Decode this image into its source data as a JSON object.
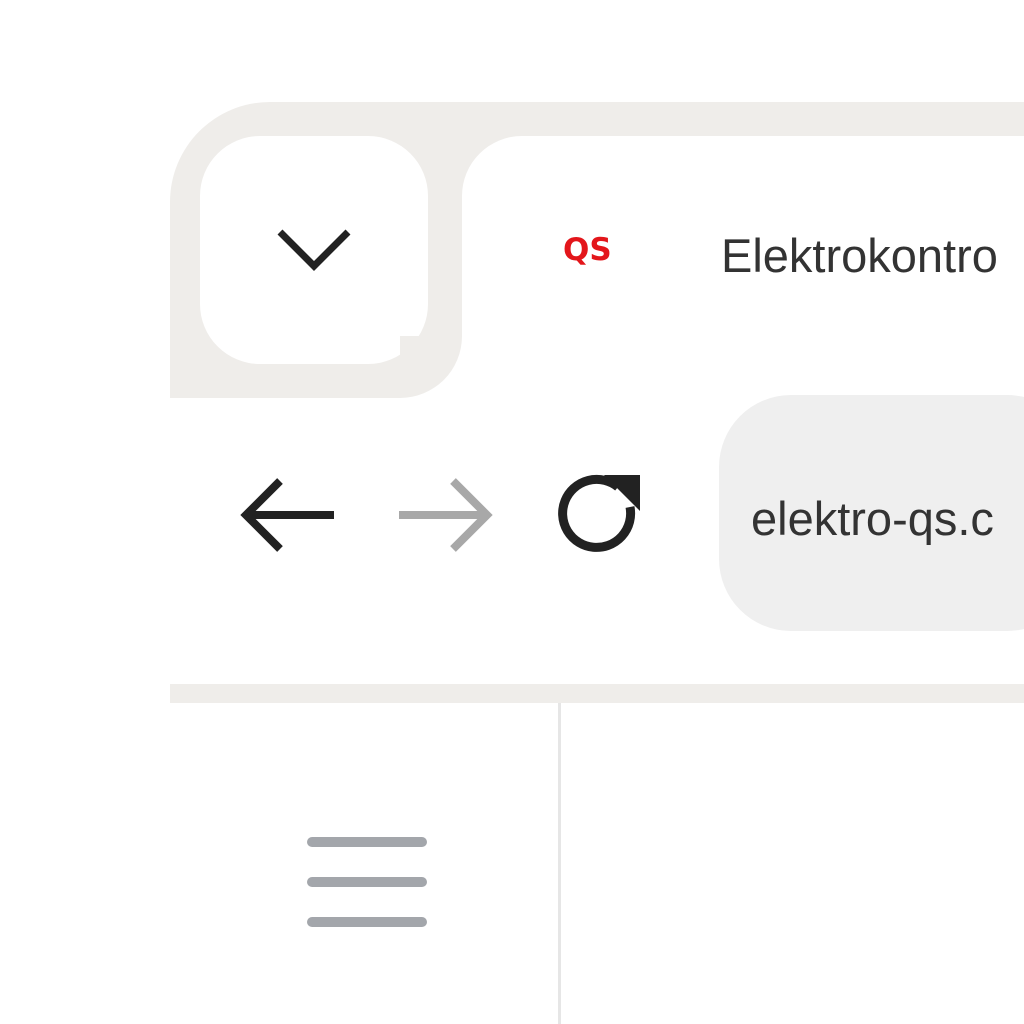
{
  "tab": {
    "favicon_text": "QS",
    "favicon_color": "#e3161b",
    "title": "Elektrokontro",
    "menu_icon": "chevron-down-icon"
  },
  "toolbar": {
    "back_icon": "arrow-left-icon",
    "forward_icon": "arrow-right-icon",
    "forward_enabled": false,
    "reload_icon": "reload-icon",
    "address_value": "elektro-qs.c"
  },
  "sidebar": {
    "menu_icon": "hamburger-menu-icon"
  },
  "colors": {
    "tabstrip_bg": "#efedea",
    "omnibox_bg": "#efefef",
    "icon_dark": "#222222",
    "icon_disabled": "#a8a8a8",
    "hamburger": "#a3a6ab"
  }
}
